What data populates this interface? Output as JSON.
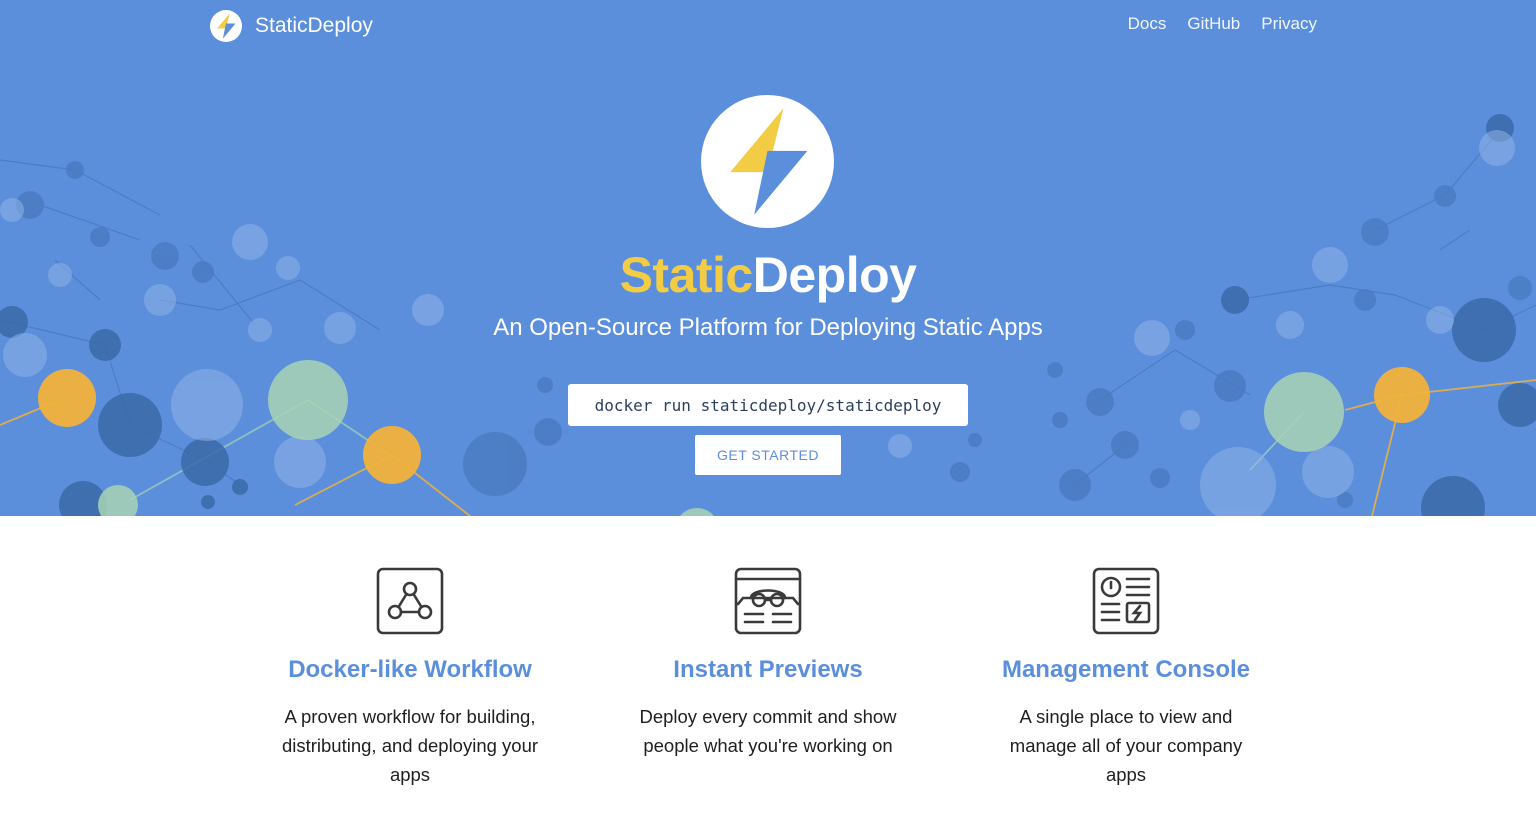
{
  "navbar": {
    "brand": "StaticDeploy",
    "links": [
      "Docs",
      "GitHub",
      "Privacy"
    ]
  },
  "hero": {
    "title_part1": "Static",
    "title_part2": "Deploy",
    "subtitle": "An Open-Source Platform for Deploying Static Apps",
    "command": "docker run staticdeploy/staticdeploy",
    "cta_label": "GET STARTED"
  },
  "features": [
    {
      "icon": "workflow-graph-icon",
      "title": "Docker-like Workflow",
      "description": "A proven workflow for building, distributing, and deploying your apps"
    },
    {
      "icon": "preview-glasses-icon",
      "title": "Instant Previews",
      "description": "Deploy every commit and show people what you're working on"
    },
    {
      "icon": "console-dashboard-icon",
      "title": "Management Console",
      "description": "A single place to view and manage all of your company apps"
    }
  ],
  "colors": {
    "hero_bg": "#5b8fdc",
    "accent_yellow": "#f3cc45",
    "link_blue": "#5b8fdc",
    "node_dark": "#3b6aa8",
    "node_orange": "#f2b23b",
    "node_green": "#a8d4b4"
  }
}
